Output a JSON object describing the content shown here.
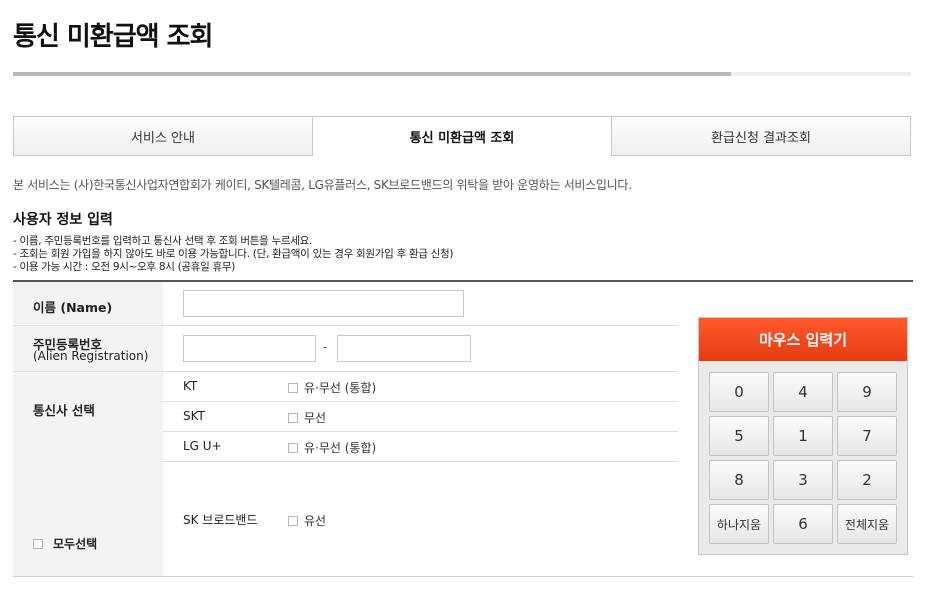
{
  "page": {
    "title": "통신 미환급액 조회",
    "progress_fraction": 0.8
  },
  "tabs": [
    {
      "label": "서비스 안내",
      "active": false
    },
    {
      "label": "통신 미환급액 조회",
      "active": true
    },
    {
      "label": "환급신청 결과조회",
      "active": false
    }
  ],
  "intro": "본 서비스는 (사)한국통신사업자연합회가 케이티, SK텔레콤, LG유플러스, SK브로드밴드의 위탁을 받아 운영하는 서비스입니다.",
  "user_info": {
    "title": "사용자 정보 입력",
    "notes": [
      "- 이름, 주민등록번호를 입력하고 통신사 선택 후 조회 버튼을 누르세요.",
      "- 조회는 회원 가입을 하지 않아도 바로 이용 가능합니다. (단, 환급액이 있는 경우 회원가입 후 환급 신청)",
      "- 이용 가능 시간 : 오전 9시~오후 8시 (공휴일 휴무)"
    ]
  },
  "form": {
    "name_label": "이름 (Name)",
    "name_value": "",
    "rrn_label": "주민등록번호",
    "rrn_sub": "(Alien Registration)",
    "rrn_front_value": "",
    "rrn_back_value": "",
    "rrn_separator": "-",
    "carrier_label": "통신사 선택",
    "select_all_label": "모두선택",
    "carriers": [
      {
        "name": "KT",
        "option": "유·무선 (통합)",
        "checked": false
      },
      {
        "name": "SKT",
        "option": "무선",
        "checked": false
      },
      {
        "name": "LG U+",
        "option": "유·무선 (통합)",
        "checked": false
      },
      {
        "name": "SK 브로드밴드",
        "option": "유선",
        "checked": false
      }
    ]
  },
  "keypad": {
    "title": "마우스 입력기",
    "keys": [
      "0",
      "4",
      "9",
      "5",
      "1",
      "7",
      "8",
      "3",
      "2",
      "하나지움",
      "6",
      "전체지움"
    ]
  },
  "colors": {
    "accent": "#e8441a",
    "label_bg": "#f3f3f3"
  }
}
